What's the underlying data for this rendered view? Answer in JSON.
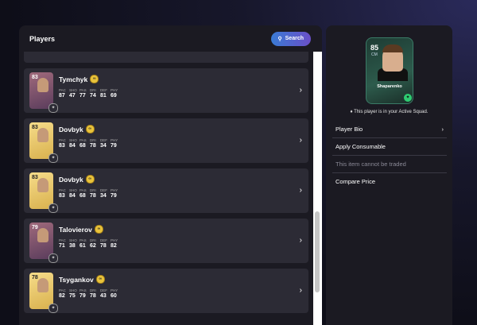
{
  "players_panel": {
    "title": "Players",
    "search_label": "Search"
  },
  "players": [
    {
      "rating": "83",
      "name": "Tymchyk",
      "card": "purple",
      "stats": {
        "PAC": "87",
        "SHO": "47",
        "PAS": "77",
        "DRI": "74",
        "DEF": "81",
        "PHY": "69"
      }
    },
    {
      "rating": "83",
      "name": "Dovbyk",
      "card": "gold",
      "stats": {
        "PAC": "83",
        "SHO": "84",
        "PAS": "68",
        "DRI": "78",
        "DEF": "34",
        "PHY": "79"
      }
    },
    {
      "rating": "83",
      "name": "Dovbyk",
      "card": "gold",
      "stats": {
        "PAC": "83",
        "SHO": "84",
        "PAS": "68",
        "DRI": "78",
        "DEF": "34",
        "PHY": "79"
      }
    },
    {
      "rating": "79",
      "name": "Talovierov",
      "card": "purple",
      "stats": {
        "PAC": "71",
        "SHO": "38",
        "PAS": "61",
        "DRI": "62",
        "DEF": "78",
        "PHY": "82"
      }
    },
    {
      "rating": "78",
      "name": "Tsygankov",
      "card": "gold",
      "stats": {
        "PAC": "82",
        "SHO": "75",
        "PAS": "79",
        "DRI": "78",
        "DEF": "43",
        "PHY": "60"
      }
    }
  ],
  "stat_labels": [
    "PAC",
    "SHO",
    "PAS",
    "DRI",
    "DEF",
    "PHY"
  ],
  "selected_player": {
    "rating": "85",
    "position": "CM",
    "name": "Shaparenko"
  },
  "squad_note": "This player is in your Active Squad.",
  "menu": [
    {
      "label": "Player Bio",
      "chevron": true,
      "enabled": true
    },
    {
      "label": "Apply Consumable",
      "chevron": false,
      "enabled": true
    },
    {
      "label": "This item cannot be traded",
      "chevron": false,
      "enabled": false
    },
    {
      "label": "Compare Price",
      "chevron": false,
      "enabled": true
    }
  ],
  "colors": {
    "accent": "#3a7bd5",
    "panel": "#1b1a22",
    "row": "#2c2b35"
  }
}
